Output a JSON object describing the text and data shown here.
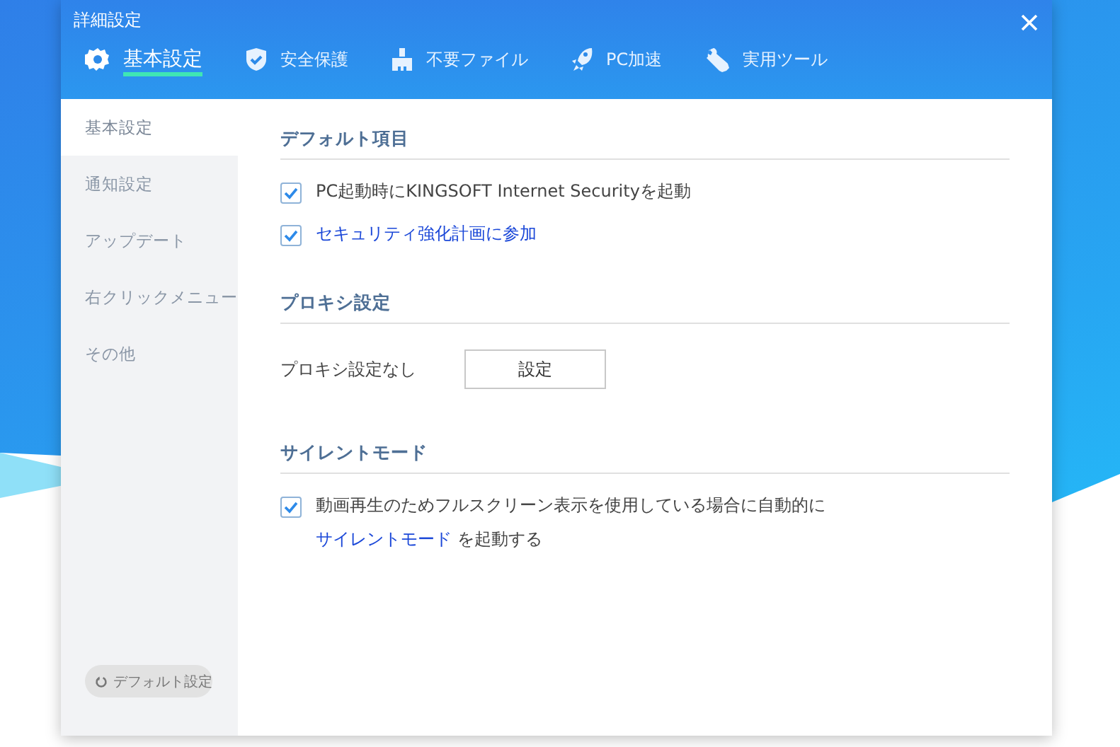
{
  "window": {
    "title": "詳細設定"
  },
  "tabs": [
    {
      "label": "基本設定",
      "selected": true
    },
    {
      "label": "安全保護",
      "selected": false
    },
    {
      "label": "不要ファイル",
      "selected": false
    },
    {
      "label": "PC加速",
      "selected": false
    },
    {
      "label": "実用ツール",
      "selected": false
    }
  ],
  "sidebar": {
    "items": [
      {
        "label": "基本設定",
        "selected": true
      },
      {
        "label": "通知設定",
        "selected": false
      },
      {
        "label": "アップデート",
        "selected": false
      },
      {
        "label": "右クリックメニュー",
        "selected": false
      },
      {
        "label": "その他",
        "selected": false
      }
    ],
    "reset_button": "デフォルト設定"
  },
  "sections": [
    {
      "title": "デフォルト項目",
      "items": [
        {
          "kind": "checkbox",
          "checked": true,
          "link": false,
          "text": "PC起動時にKINGSOFT Internet Securityを起動"
        },
        {
          "kind": "checkbox",
          "checked": true,
          "link": true,
          "text": "セキュリティ強化計画に参加"
        }
      ]
    },
    {
      "title": "プロキシ設定",
      "items": [
        {
          "kind": "button_row",
          "label": "プロキシ設定なし",
          "button": "設定"
        }
      ]
    },
    {
      "title": "サイレントモード",
      "items": [
        {
          "kind": "checkbox",
          "checked": true,
          "text": "動画再生のためフルスクリーン表示を使用している場合に自動的に",
          "link_text": "サイレントモード",
          "text_after": "を起動する"
        }
      ]
    }
  ]
}
